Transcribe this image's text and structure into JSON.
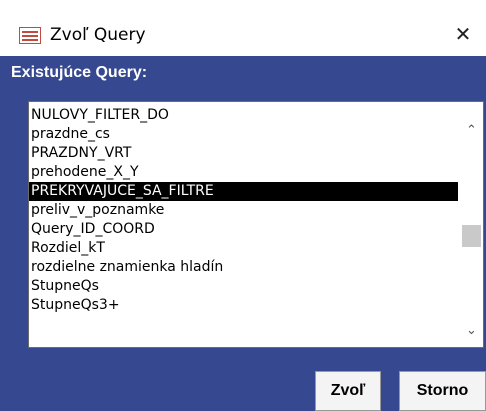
{
  "window": {
    "title": "Zvoľ Query",
    "close_glyph": "✕"
  },
  "label": "Existujúce Query:",
  "list": {
    "items": [
      {
        "text": "NULOVY_FILTER_DO",
        "selected": false
      },
      {
        "text": "prazdne_cs",
        "selected": false
      },
      {
        "text": "PRAZDNY_VRT",
        "selected": false
      },
      {
        "text": "prehodene_X_Y",
        "selected": false
      },
      {
        "text": "PREKRYVAJUCE_SA_FILTRE",
        "selected": true
      },
      {
        "text": "preliv_v_poznamke",
        "selected": false
      },
      {
        "text": "Query_ID_COORD",
        "selected": false
      },
      {
        "text": "Rozdiel_kT",
        "selected": false
      },
      {
        "text": "rozdielne znamienka hladín",
        "selected": false
      },
      {
        "text": "StupneQs",
        "selected": false
      },
      {
        "text": "StupneQs3+",
        "selected": false
      }
    ],
    "scroll_up_glyph": "⌃",
    "scroll_down_glyph": "⌄"
  },
  "buttons": {
    "ok_label": "Zvoľ",
    "cancel_label": "Storno"
  },
  "colors": {
    "panel": "#36488f",
    "selection": "#000000",
    "icon": "#c24a3f"
  },
  "icons": {
    "app": "form-icon",
    "close": "close-icon"
  }
}
